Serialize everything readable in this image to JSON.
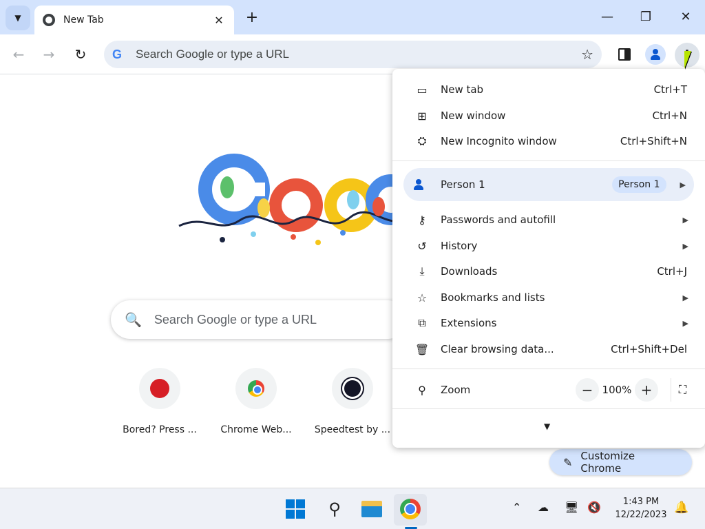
{
  "browser": {
    "tab": {
      "title": "New Tab"
    },
    "omnibox_text": "Search Google or type a URL"
  },
  "page": {
    "search_placeholder": "Search Google or type a URL",
    "shortcuts": [
      {
        "label": "Bored? Press ..."
      },
      {
        "label": "Chrome Web..."
      },
      {
        "label": "Speedtest by ..."
      }
    ],
    "customize_label": "Customize Chrome"
  },
  "menu": {
    "items_top": [
      {
        "icon": "new-tab-icon",
        "label": "New tab",
        "shortcut": "Ctrl+T"
      },
      {
        "icon": "new-window-icon",
        "label": "New window",
        "shortcut": "Ctrl+N"
      },
      {
        "icon": "incognito-icon",
        "label": "New Incognito window",
        "shortcut": "Ctrl+Shift+N"
      }
    ],
    "person": {
      "label": "Person 1",
      "chip": "Person 1"
    },
    "items_mid": [
      {
        "icon": "key-icon",
        "label": "Passwords and autofill",
        "shortcut": ""
      },
      {
        "icon": "history-icon",
        "label": "History",
        "shortcut": ""
      },
      {
        "icon": "download-icon",
        "label": "Downloads",
        "shortcut": "Ctrl+J"
      },
      {
        "icon": "star-icon",
        "label": "Bookmarks and lists",
        "shortcut": ""
      },
      {
        "icon": "extensions-icon",
        "label": "Extensions",
        "shortcut": ""
      },
      {
        "icon": "trash-icon",
        "label": "Clear browsing data...",
        "shortcut": "Ctrl+Shift+Del"
      }
    ],
    "zoom": {
      "label": "Zoom",
      "value": "100%",
      "minus": "−",
      "plus": "+"
    }
  },
  "taskbar": {
    "time": "1:43 PM",
    "date": "12/22/2023"
  },
  "colors": {
    "titlebar": "#d3e3fd",
    "accent": "#0b57d0",
    "menu_person_bg": "#e8eef9"
  }
}
